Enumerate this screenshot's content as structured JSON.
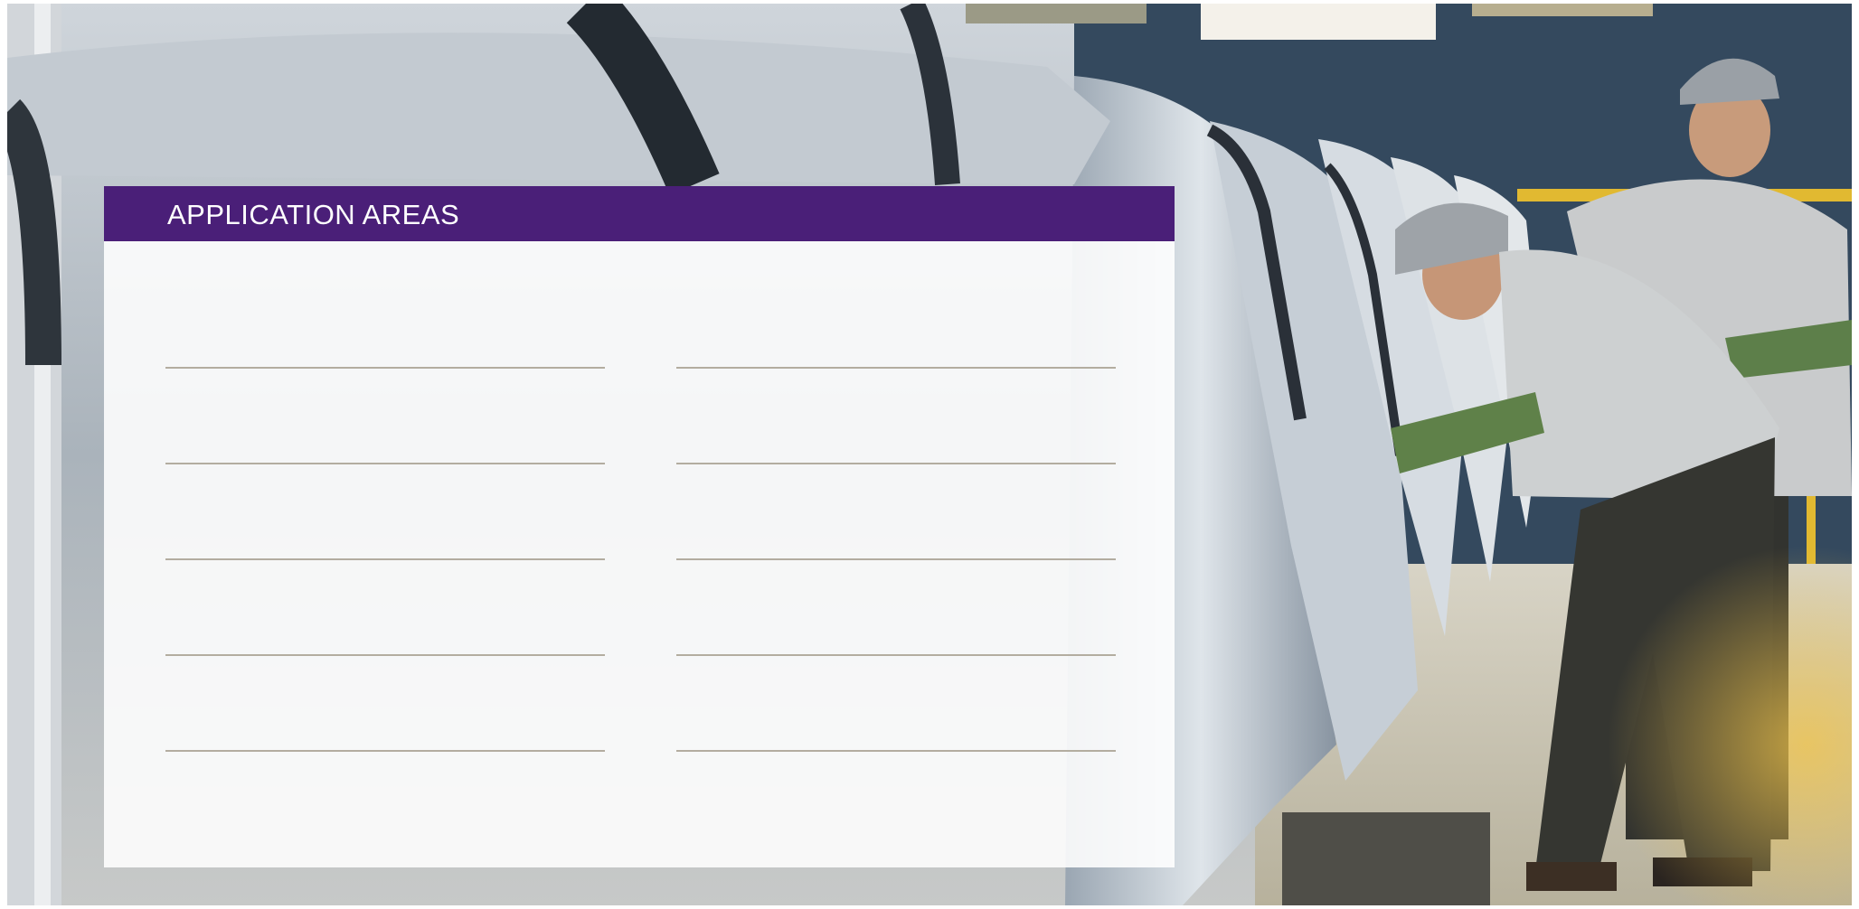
{
  "panel": {
    "title": "APPLICATION AREAS"
  },
  "entry_rows": {
    "left": [
      "",
      "",
      "",
      "",
      ""
    ],
    "right": [
      "",
      "",
      "",
      "",
      ""
    ]
  },
  "colors": {
    "header": "#4a1f78",
    "header_text": "#ffffff",
    "line": "#b3ada0"
  }
}
